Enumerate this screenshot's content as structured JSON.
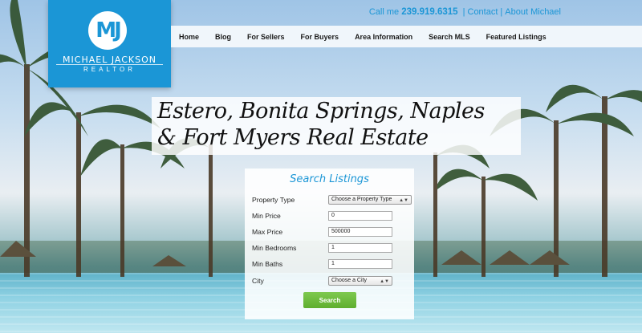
{
  "logo": {
    "monogram": "MJ",
    "name": "MICHAEL JACKSON",
    "subtitle": "REALTOR"
  },
  "contact": {
    "call_label": "Call me",
    "phone": "239.919.6315",
    "contact_link": "Contact",
    "about_link": "About Michael"
  },
  "nav": {
    "items": [
      {
        "label": "Home"
      },
      {
        "label": "Blog"
      },
      {
        "label": "For Sellers"
      },
      {
        "label": "For Buyers"
      },
      {
        "label": "Area Information"
      },
      {
        "label": "Search MLS"
      },
      {
        "label": "Featured Listings"
      }
    ]
  },
  "headline": {
    "line1": "Estero, Bonita Springs, Naples",
    "line2": "& Fort Myers Real Estate"
  },
  "search": {
    "title": "Search Listings",
    "property_type": {
      "label": "Property Type",
      "value": "Choose a Property Type"
    },
    "min_price": {
      "label": "Min Price",
      "value": "0"
    },
    "max_price": {
      "label": "Max Price",
      "value": "500000"
    },
    "min_bedrooms": {
      "label": "Min Bedrooms",
      "value": "1"
    },
    "min_baths": {
      "label": "Min Baths",
      "value": "1"
    },
    "city": {
      "label": "City",
      "value": "Choose a City"
    },
    "button_label": "Search"
  },
  "colors": {
    "brand_blue": "#1b96d6",
    "button_green": "#6cbb3c"
  }
}
